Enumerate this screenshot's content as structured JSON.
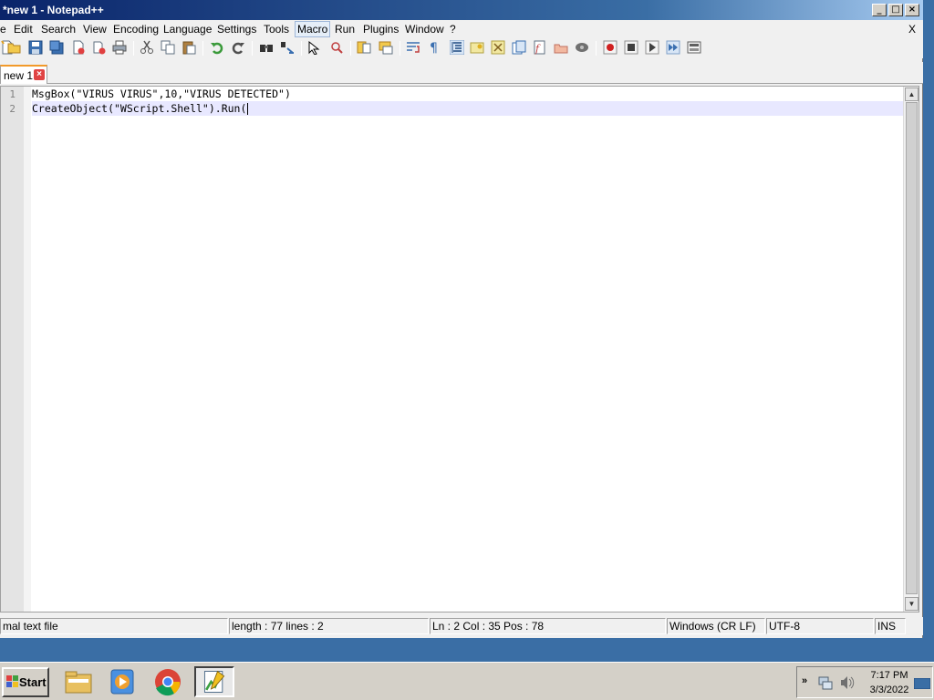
{
  "window": {
    "title": "*new 1 - Notepad++",
    "controls": {
      "minimize": "_",
      "maximize": "□",
      "close": "×"
    }
  },
  "menubar": {
    "items": [
      "e",
      "Edit",
      "Search",
      "View",
      "Encoding",
      "Language",
      "Settings",
      "Tools",
      "Macro",
      "Run",
      "Plugins",
      "Window",
      "?"
    ],
    "close_doc": "X"
  },
  "tab": {
    "label": "new 1"
  },
  "editor": {
    "lines": [
      {
        "num": "1",
        "text": "MsgBox(\"VIRUS VIRUS\",10,\"VIRUS DETECTED\")"
      },
      {
        "num": "2",
        "text": "CreateObject(\"WScript.Shell\").Run("
      }
    ]
  },
  "status": {
    "type": "mal text file",
    "length": "length : 77    lines : 2",
    "position": "Ln : 2    Col : 35    Pos : 78",
    "eol": "Windows (CR LF)",
    "encoding": "UTF-8",
    "mode": "INS"
  },
  "taskbar": {
    "start_label": "Start",
    "clock_time": "7:17 PM",
    "clock_date": "3/3/2022",
    "tray_chevron": "»"
  }
}
